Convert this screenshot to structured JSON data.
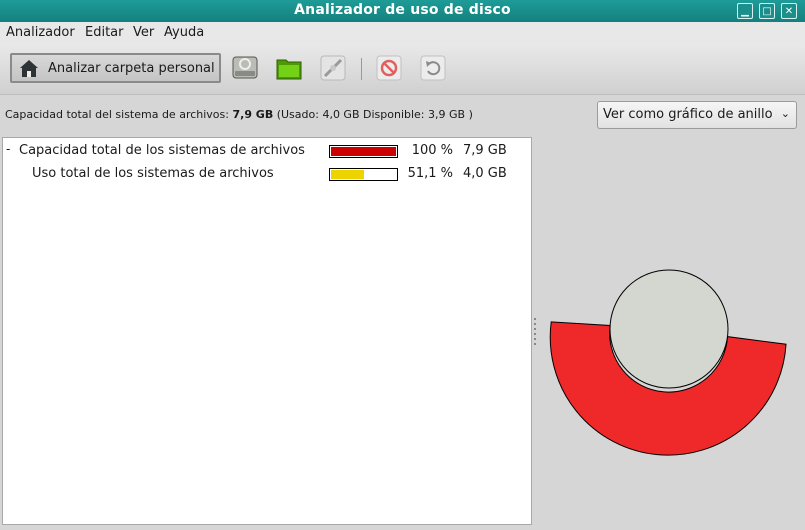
{
  "window": {
    "title": "Analizador de uso de disco"
  },
  "menubar": {
    "items": [
      "Analizador",
      "Editar",
      "Ver",
      "Ayuda"
    ]
  },
  "toolbar": {
    "home_label": "Analizar carpeta personal",
    "icons": [
      "scan-filesystem-icon",
      "scan-folder-icon",
      "scan-remote-icon",
      "stop-icon",
      "refresh-icon"
    ]
  },
  "info": {
    "prefix": "Capacidad total del sistema de archivos: ",
    "total": "7,9 GB",
    "detail": " (Usado: 4,0 GB Disponible: 3,9 GB )"
  },
  "view_select": {
    "selected": "Ver como gráfico de anillo"
  },
  "tree": {
    "rows": [
      {
        "expander": "-",
        "name": "Capacidad total de los sistemas de archivos",
        "percent": "100 %",
        "size": "7,9 GB",
        "fraction": 1.0,
        "color": "#cc0000"
      },
      {
        "expander": "",
        "name": "Uso total de los sistemas de archivos",
        "percent": "51,1 %",
        "size": "4,0 GB",
        "fraction": 0.511,
        "color": "#edd400"
      }
    ]
  },
  "ring_chart": {
    "outer_color": "#ef2929",
    "center_color": "#d3d7cf",
    "used_fraction": 0.511
  }
}
